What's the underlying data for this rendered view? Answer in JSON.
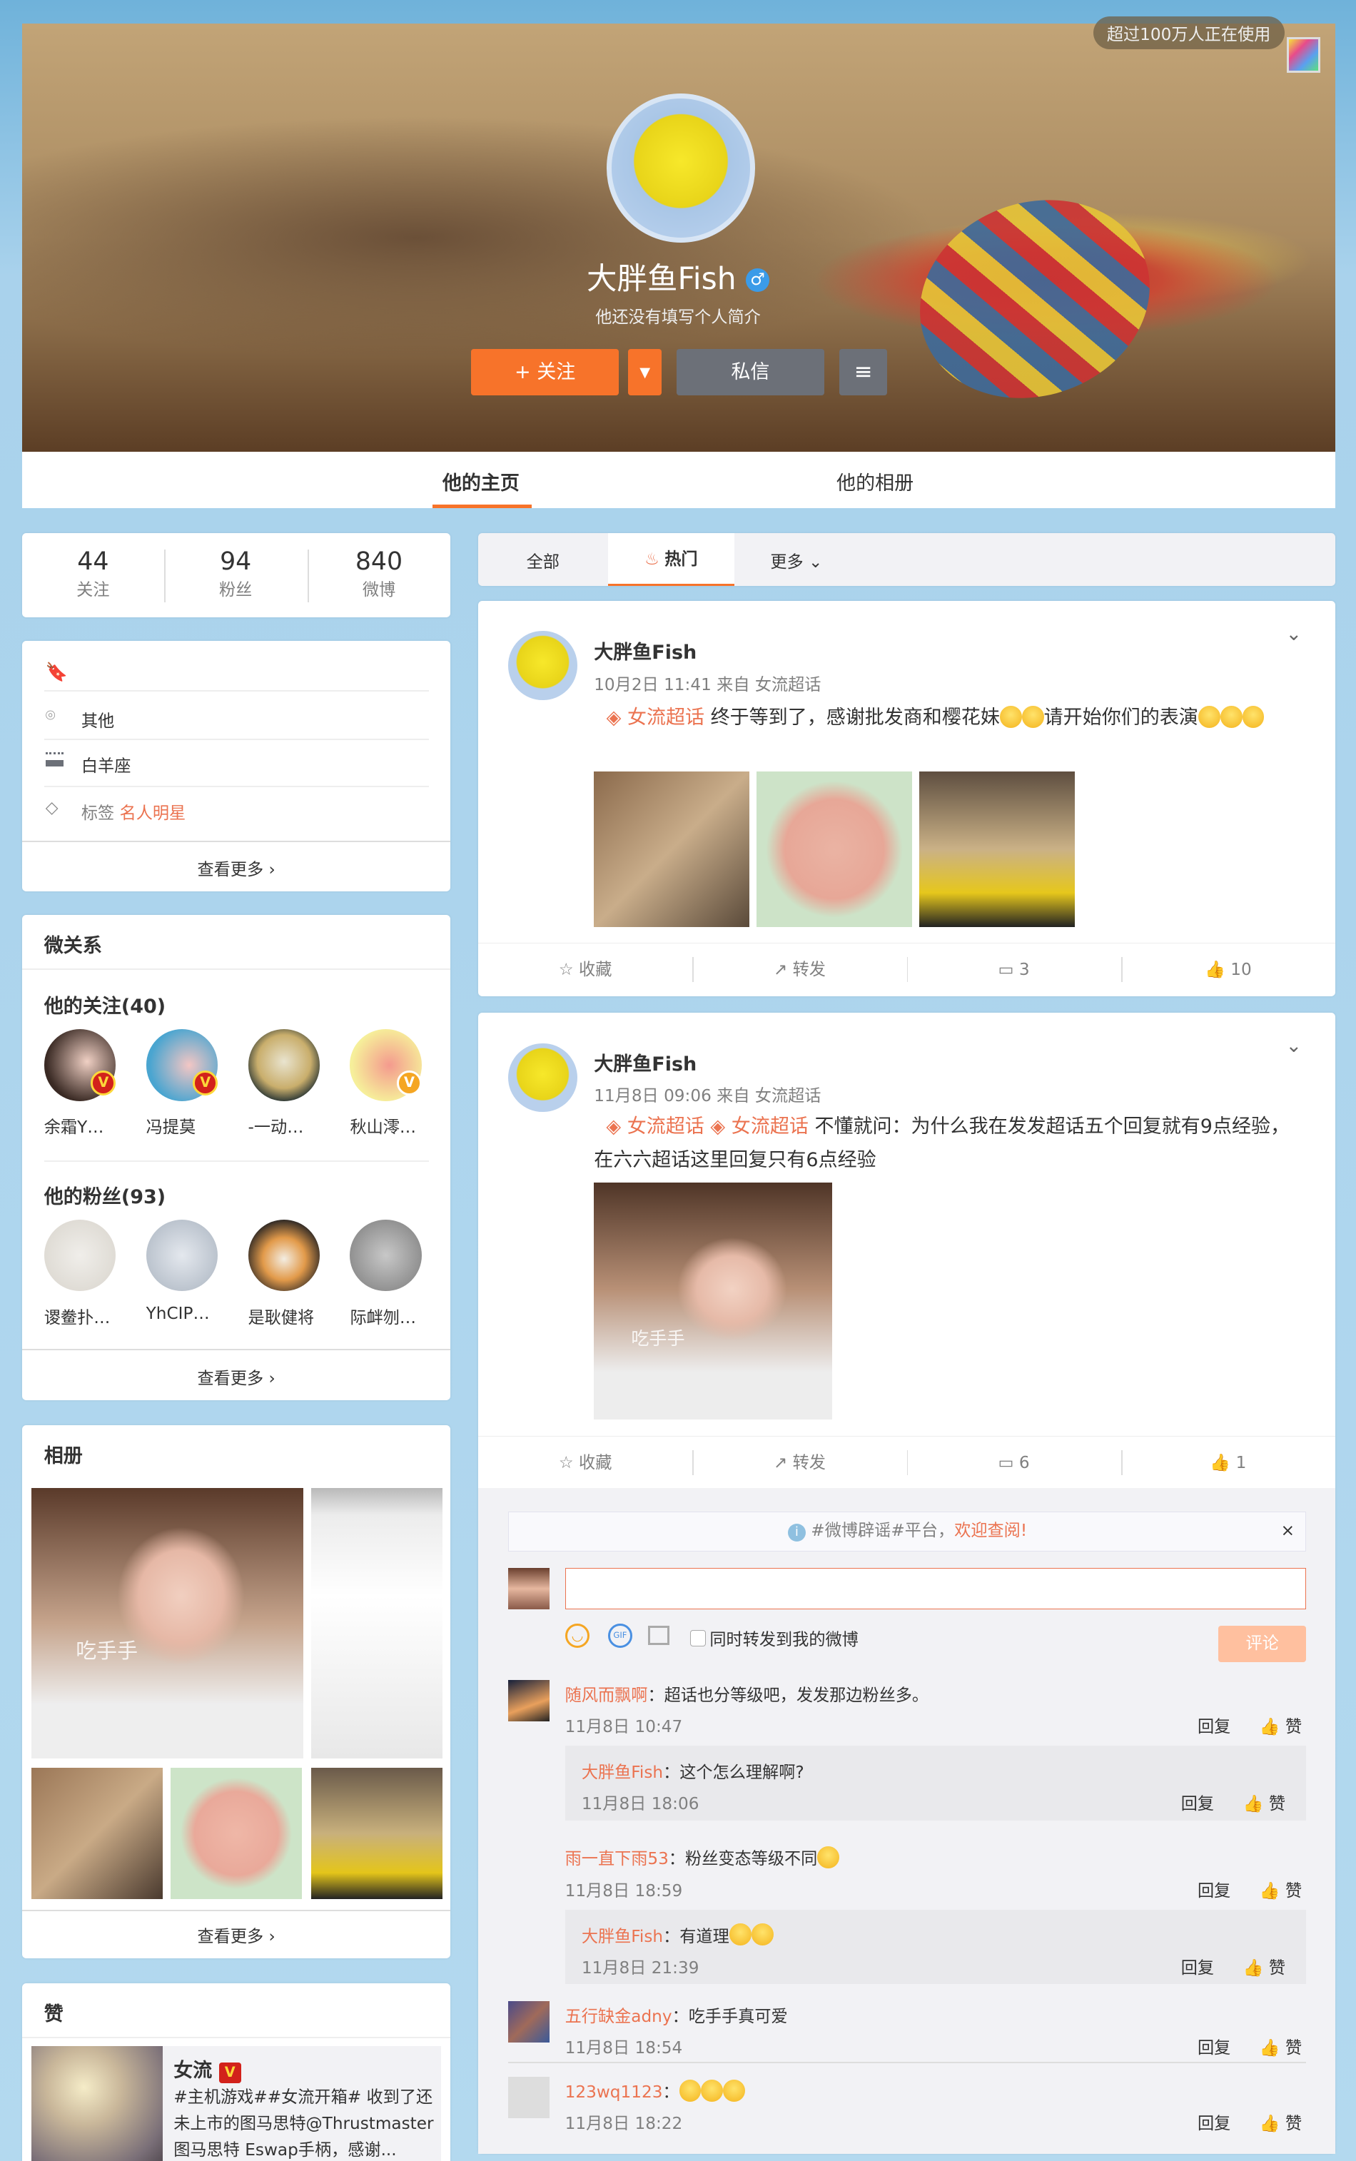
{
  "header": {
    "promo": "超过100万人正在使用",
    "name": "大胖鱼Fish",
    "gender": "male",
    "bio": "他还没有填写个人简介",
    "follow": "+ 关注",
    "message": "私信"
  },
  "tabs": [
    "他的主页",
    "他的相册"
  ],
  "stats": [
    {
      "n": "44",
      "l": "关注"
    },
    {
      "n": "94",
      "l": "粉丝"
    },
    {
      "n": "840",
      "l": "微博"
    }
  ],
  "info": {
    "location": "其他",
    "birthday": "白羊座",
    "tag_label": "标签",
    "tag": "名人明星",
    "more": "查看更多"
  },
  "relations": {
    "title": "微关系",
    "following_title": "他的关注(40)",
    "following": [
      "余霜Y…",
      "冯提莫",
      "-一动…",
      "秋山澪…"
    ],
    "fans_title": "他的粉丝(93)",
    "fans": [
      "谡鲞扑…",
      "YhCIP…",
      "是耿健将",
      "际衅刎…"
    ],
    "more": "查看更多"
  },
  "album": {
    "title": "相册",
    "overlay": "吃手手",
    "more": "查看更多"
  },
  "likes": {
    "title": "赞",
    "user": "女流",
    "text": "#主机游戏##女流开箱# 收到了还未上市的图马思特@Thrustmaster 图马思特 Eswap手柄，感谢..."
  },
  "feed_tabs": [
    "全部",
    "热门",
    "更多"
  ],
  "posts": [
    {
      "user": "大胖鱼Fish",
      "meta": "10月2日 11:41 来自 女流超话",
      "topic": "女流超话",
      "text": "终于等到了，感谢批发商和樱花妹",
      "text2": "请开始你们的表演",
      "fav": "收藏",
      "fwd": "转发",
      "cmt": "3",
      "like": "10"
    },
    {
      "user": "大胖鱼Fish",
      "meta": "11月8日 09:06 来自 女流超话",
      "topic": "女流超话",
      "text": "不懂就问：为什么我在发发超话五个回复就有9点经验，在六六超话这里回复只有6点经验",
      "overlay": "吃手手",
      "fav": "收藏",
      "fwd": "转发",
      "cmt": "6",
      "like": "1"
    }
  ],
  "comments": {
    "notice": "#微博辟谣#平台，",
    "notice_link": "欢迎查阅!",
    "close": "×",
    "forward_label": "同时转发到我的微博",
    "submit": "评论",
    "reply": "回复",
    "like": "赞",
    "list": [
      {
        "user": "随风而飘啊",
        "text": "：超话也分等级吧，发发那边粉丝多。",
        "time": "11月8日 10:47"
      },
      {
        "user": "大胖鱼Fish",
        "text": "：这个怎么理解啊?",
        "time": "11月8日 18:06",
        "sub": true
      },
      {
        "user": "雨一直下雨53",
        "text": "：粉丝变态等级不同",
        "time": "11月8日 18:59"
      },
      {
        "user": "大胖鱼Fish",
        "text": "：有道理",
        "time": "11月8日 21:39",
        "sub": true
      },
      {
        "user": "五行缺金adny",
        "text": "：吃手手真可爱",
        "time": "11月8日 18:54"
      },
      {
        "user": "123wq1123",
        "text": "：",
        "time": "11月8日 18:22"
      }
    ]
  },
  "colors": {
    "accent": "#ff8140",
    "link": "#eb7350",
    "bg": "#acd4ec"
  }
}
